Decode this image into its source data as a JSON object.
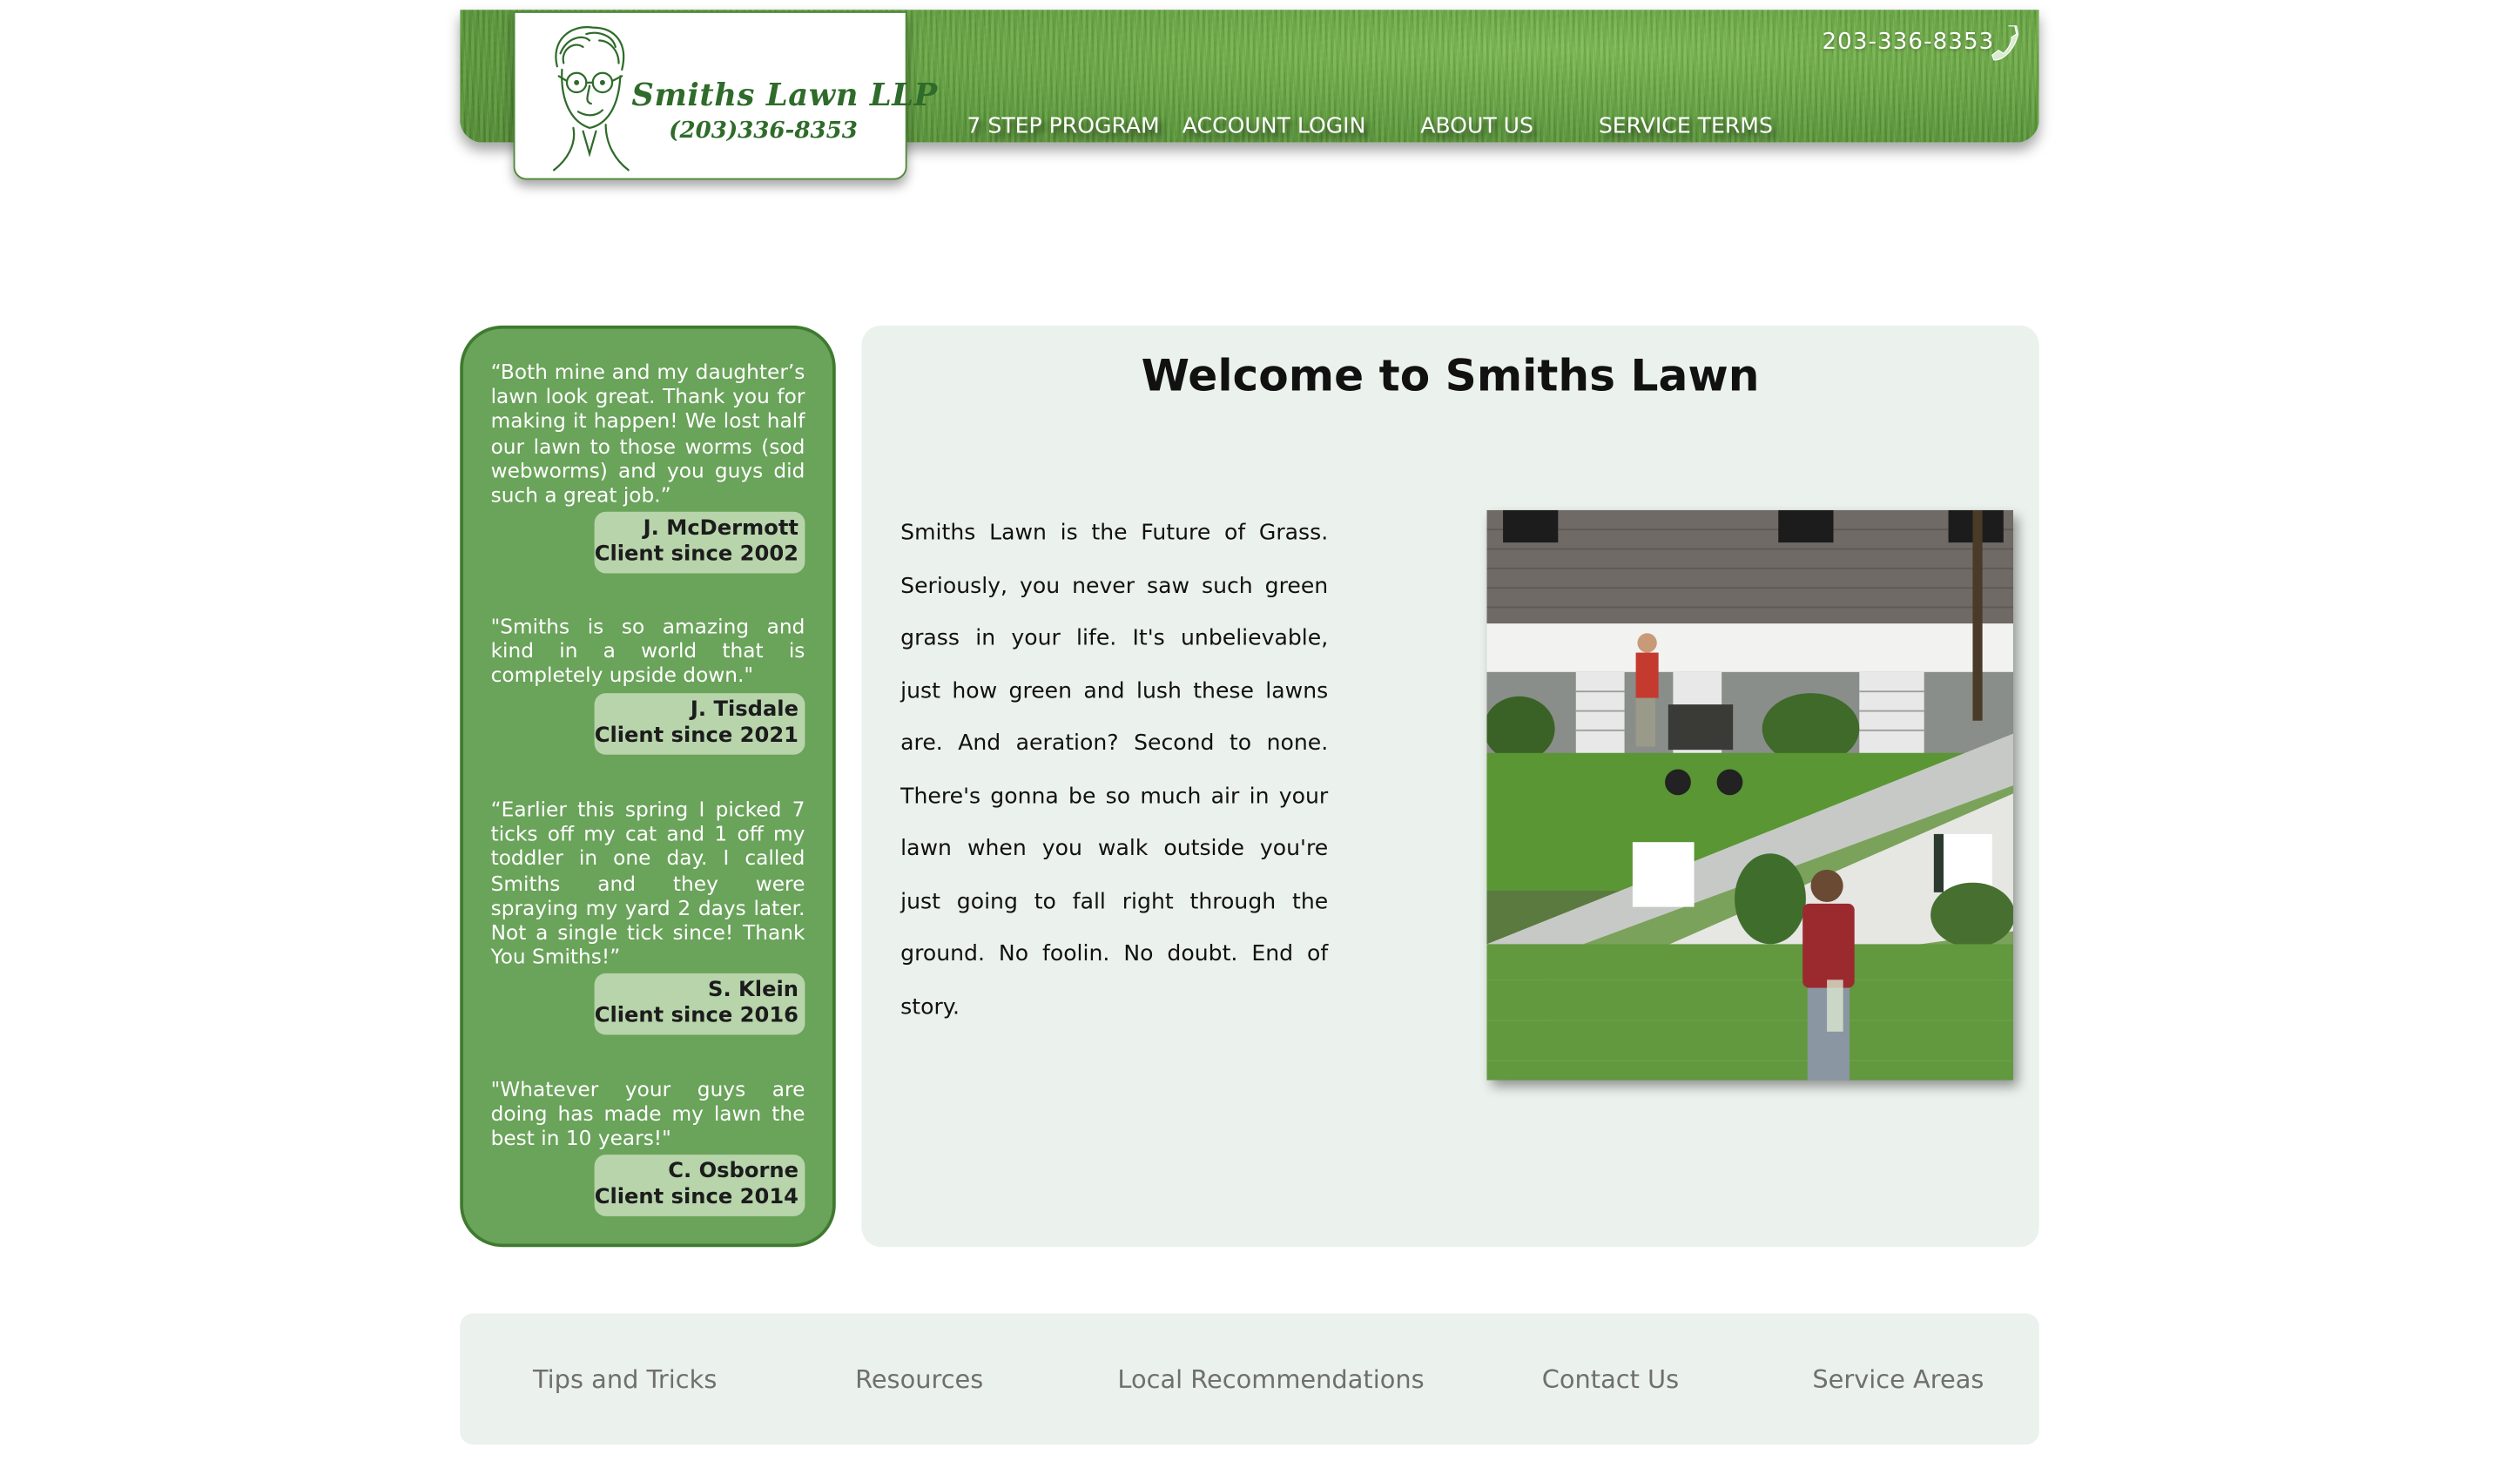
{
  "header": {
    "logo_name": "Smiths Lawn LLP",
    "logo_phone": "(203)336-8353",
    "phone": "203-336-8353",
    "nav": [
      {
        "label": "7 STEP PROGRAM"
      },
      {
        "label": "ACCOUNT LOGIN"
      },
      {
        "label": "ABOUT US"
      },
      {
        "label": "SERVICE TERMS"
      }
    ]
  },
  "testimonials": [
    {
      "quote": "“Both mine and my daughter’s lawn look great. Thank you for making it happen! We lost half our lawn to those worms (sod webworms) and you guys did such a great job.”",
      "name": "J. McDermott",
      "since": "Client since 2002"
    },
    {
      "quote": "\"Smiths is so amazing and kind in a world that is completely upside down.\"",
      "name": "J. Tisdale",
      "since": "Client since 2021"
    },
    {
      "quote": "“Earlier this spring I picked 7 ticks off my cat and 1 off my toddler in one day. I called Smiths and they were spraying my yard 2 days later. Not a single tick since! Thank You Smiths!”",
      "name": "S. Klein",
      "since": "Client since 2016"
    },
    {
      "quote": "\"Whatever your guys are doing has made my lawn the best in 10 years!\"",
      "name": "C. Osborne",
      "since": "Client since 2014"
    }
  ],
  "main": {
    "title": "Welcome to Smiths Lawn",
    "intro": "Smiths Lawn is the Future of Grass. Seriously, you never saw such green grass in your life. It's unbelievable, just how green and lush these lawns are. And aeration? Second to none. There's gonna be so much air in your lawn when you walk outside you're just going to fall right through the ground. No foolin. No doubt. End of story."
  },
  "footer": {
    "links": [
      {
        "label": "Tips and Tricks"
      },
      {
        "label": "Resources"
      },
      {
        "label": "Local Recommendations"
      },
      {
        "label": "Contact Us"
      },
      {
        "label": "Service Areas"
      }
    ]
  },
  "icons": {
    "phone": "phone-icon",
    "logo": "caricature-face-icon"
  },
  "colors": {
    "grass_green": "#5d9c3a",
    "sidebar_green": "#6aa35a",
    "sidebar_border": "#3f7a2e",
    "author_badge": "#b7d4ab",
    "panel_bg": "#ebf1ec",
    "footer_text": "#6f6f6f"
  }
}
